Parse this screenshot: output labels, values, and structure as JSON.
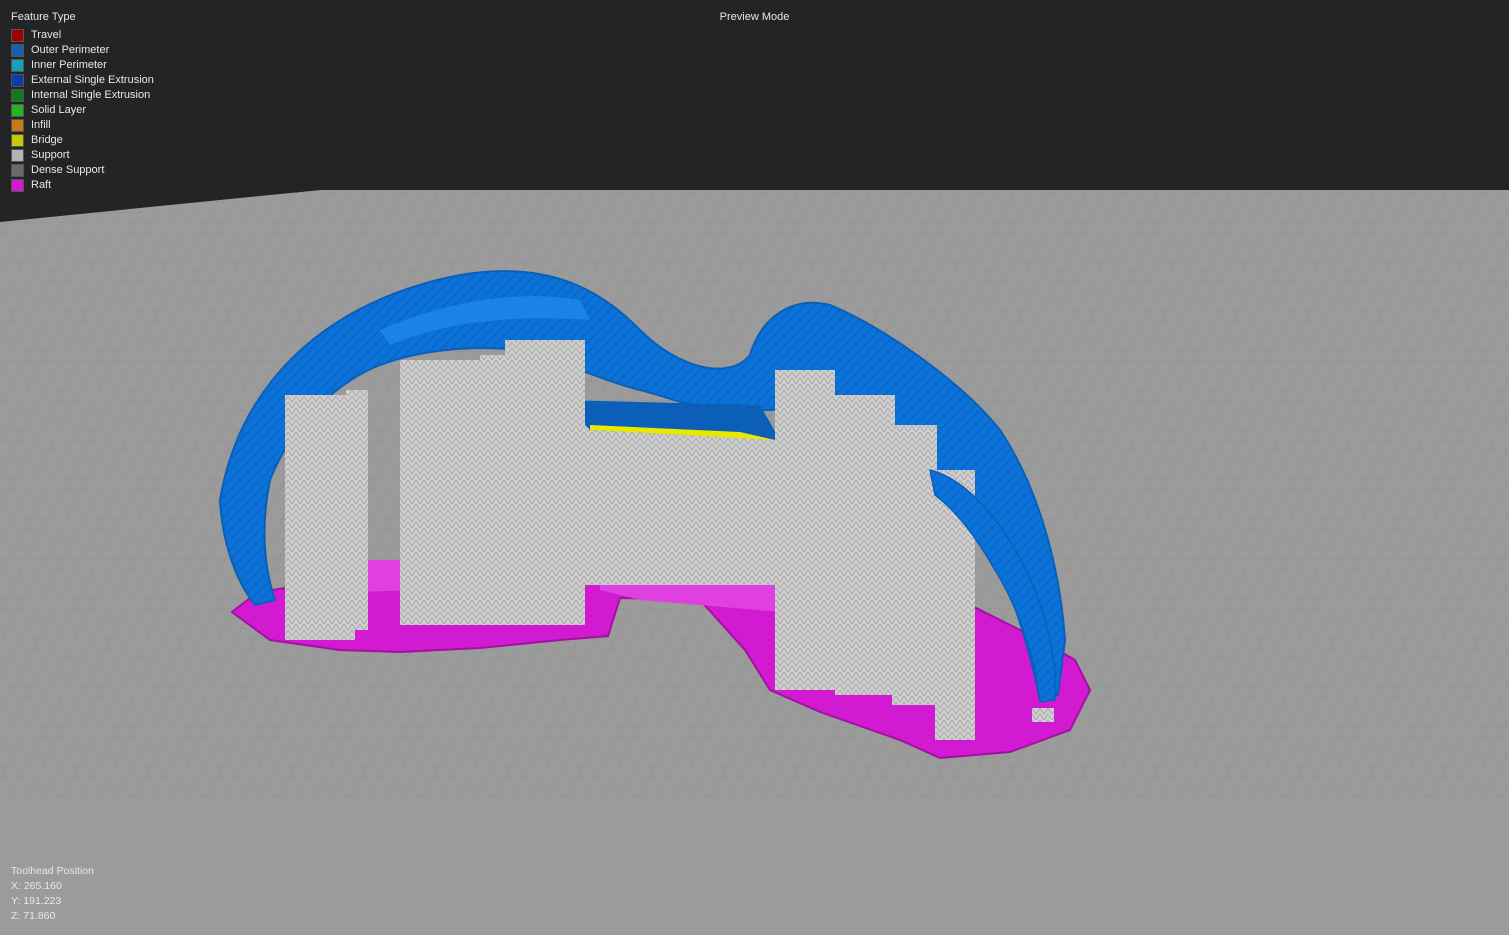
{
  "legend": {
    "title": "Feature Type",
    "items": [
      {
        "label": "Travel",
        "color": "#a00000"
      },
      {
        "label": "Outer Perimeter",
        "color": "#1a5fb4"
      },
      {
        "label": "Inner Perimeter",
        "color": "#17a2b8"
      },
      {
        "label": "External Single Extrusion",
        "color": "#0b3fa8"
      },
      {
        "label": "Internal Single Extrusion",
        "color": "#0f7a1f"
      },
      {
        "label": "Solid Layer",
        "color": "#22b422"
      },
      {
        "label": "Infill",
        "color": "#c87a1a"
      },
      {
        "label": "Bridge",
        "color": "#c8c800"
      },
      {
        "label": "Support",
        "color": "#b4b4b4"
      },
      {
        "label": "Dense Support",
        "color": "#6a6a6a"
      },
      {
        "label": "Raft",
        "color": "#d21ad2"
      }
    ]
  },
  "view": {
    "mode_label": "Preview Mode"
  },
  "toolhead": {
    "title": "Toolhead Position",
    "x": "X: 265.160",
    "y": "Y: 191.223",
    "z": "Z: 71.860"
  },
  "colors": {
    "background": "#222426",
    "bed": "#9a9a9a",
    "grid": "#8a8a8a",
    "raft": "#d21ad2",
    "support": "#c9c9c9",
    "perimeter": "#0a72d8",
    "bridge": "#e8e800"
  }
}
